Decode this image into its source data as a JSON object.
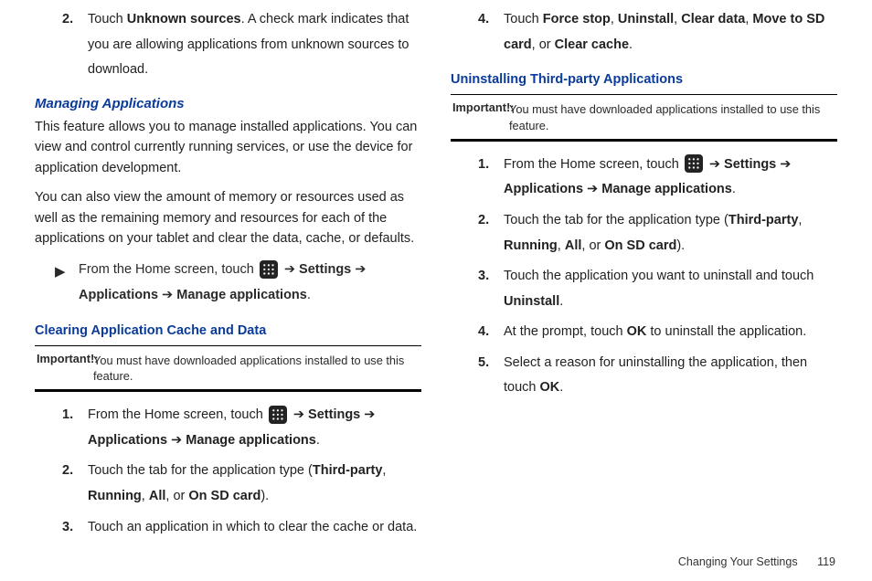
{
  "left": {
    "step2_pre": "Touch ",
    "step2_b": "Unknown sources",
    "step2_post": ". A check mark indicates that you are allowing applications from unknown sources to download.",
    "h_manage": "Managing Applications",
    "p1": "This feature allows you to manage installed applications. You can view and control currently running services, or use the device for application development.",
    "p2": "You can also view the amount of memory or resources used as well as the remaining memory and resources for each of the applications on your tablet and clear the data, cache, or defaults.",
    "nav_pre": "From the Home screen, touch ",
    "nav_arrow": " ➔ ",
    "nav_settings": "Settings",
    "nav_apps": "Applications",
    "nav_manage": "Manage applications",
    "nav_period": ".",
    "h_clear": "Clearing Application Cache and Data",
    "important_label": "Important!:",
    "important_body": "You must have downloaded applications installed to use this feature.",
    "c1_pre": "From the Home screen, touch ",
    "c2_pre": "Touch the tab for the application type (",
    "c2_tp": "Third-party",
    "c2_run": "Running",
    "c2_all": "All",
    "c2_sd": "On SD card",
    "c2_post": ").",
    "c3": "Touch an application in which to clear the cache or data.",
    "comma": ", ",
    "or": ", or "
  },
  "right": {
    "s4_pre": "Touch ",
    "s4_b1": "Force stop",
    "s4_b2": "Uninstall",
    "s4_b3": "Clear data",
    "s4_b4": "Move to SD card",
    "s4_b5": "Clear cache",
    "s4_post": ".",
    "h_uninstall": "Uninstalling Third-party Applications",
    "important_label": "Important!:",
    "important_body": "You must have downloaded applications installed to use this feature.",
    "u1_pre": "From the Home screen, touch ",
    "u2_pre": "Touch the tab for the application type (",
    "u3": "Touch the application you want to uninstall and touch ",
    "u3_b": "Uninstall",
    "u4_pre": "At the prompt, touch ",
    "u4_b": "OK",
    "u4_post": " to uninstall the application.",
    "u5_pre": "Select a reason for uninstalling the application, then touch ",
    "u5_b": "OK",
    "period": "."
  },
  "footer": {
    "section": "Changing Your Settings",
    "page": "119"
  },
  "nums": {
    "n1": "1.",
    "n2": "2.",
    "n3": "3.",
    "n4": "4.",
    "n5": "5."
  },
  "tri": "▶"
}
